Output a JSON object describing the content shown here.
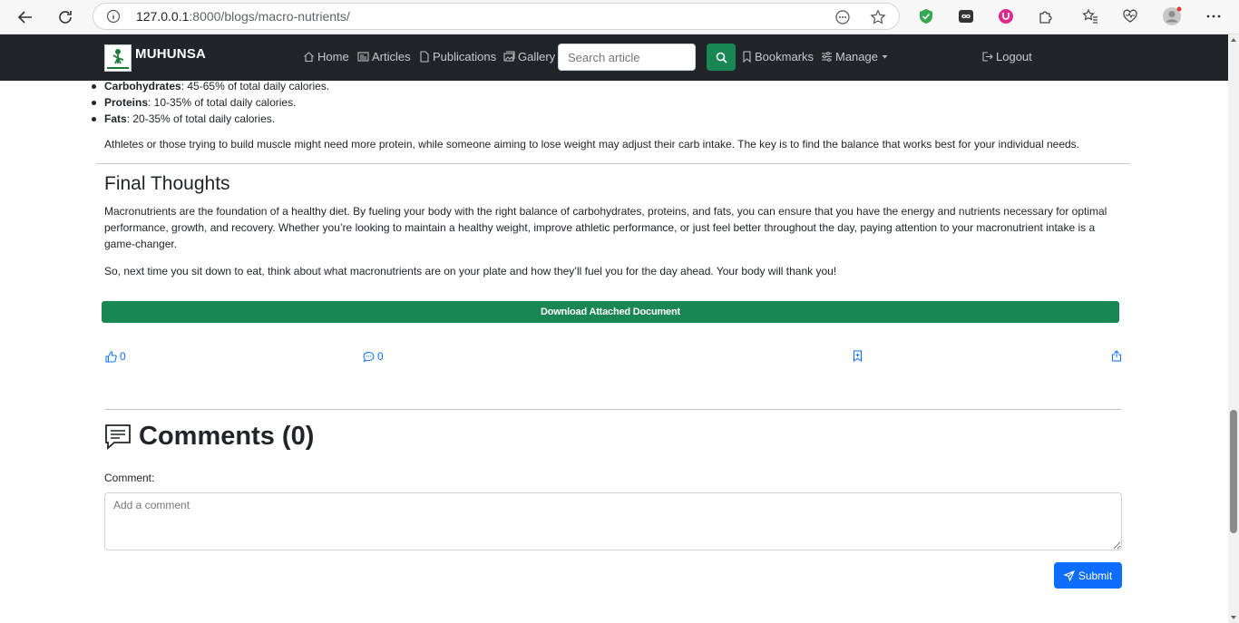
{
  "browser": {
    "url_host": "127.0.0.1",
    "url_path": ":8000/blogs/macro-nutrients/"
  },
  "nav": {
    "brand": "MUHUNSA",
    "home": "Home",
    "articles": "Articles",
    "publications": "Publications",
    "gallery": "Gallery",
    "search_placeholder": "Search article",
    "bookmarks": "Bookmarks",
    "manage": "Manage",
    "logout": "Logout"
  },
  "article": {
    "list": [
      {
        "term": "Carbohydrates",
        "desc": ": 45-65% of total daily calories."
      },
      {
        "term": "Proteins",
        "desc": ": 10-35% of total daily calories."
      },
      {
        "term": "Fats",
        "desc": ": 20-35% of total daily calories."
      }
    ],
    "para_balance": "Athletes or those trying to build muscle might need more protein, while someone aiming to lose weight may adjust their carb intake. The key is to find the balance that works best for your individual needs.",
    "section_title": "Final Thoughts",
    "para_final_1": "Macronutrients are the foundation of a healthy diet. By fueling your body with the right balance of carbohydrates, proteins, and fats, you can ensure that you have the energy and nutrients necessary for optimal performance, growth, and recovery. Whether you’re looking to maintain a healthy weight, improve athletic performance, or just feel better throughout the day, paying attention to your macronutrient intake is a game-changer.",
    "para_final_2": "So, next time you sit down to eat, think about what macronutrients are on your plate and how they’ll fuel you for the day ahead. Your body will thank you!",
    "download_label": "Download Attached Document"
  },
  "actions": {
    "likes": "0",
    "comments": "0"
  },
  "comments": {
    "title": "Comments (0)",
    "label": "Comment:",
    "placeholder": "Add a comment",
    "submit": "Submit"
  },
  "colors": {
    "navbar": "#212529",
    "success": "#198754",
    "primary": "#0d6efd"
  }
}
